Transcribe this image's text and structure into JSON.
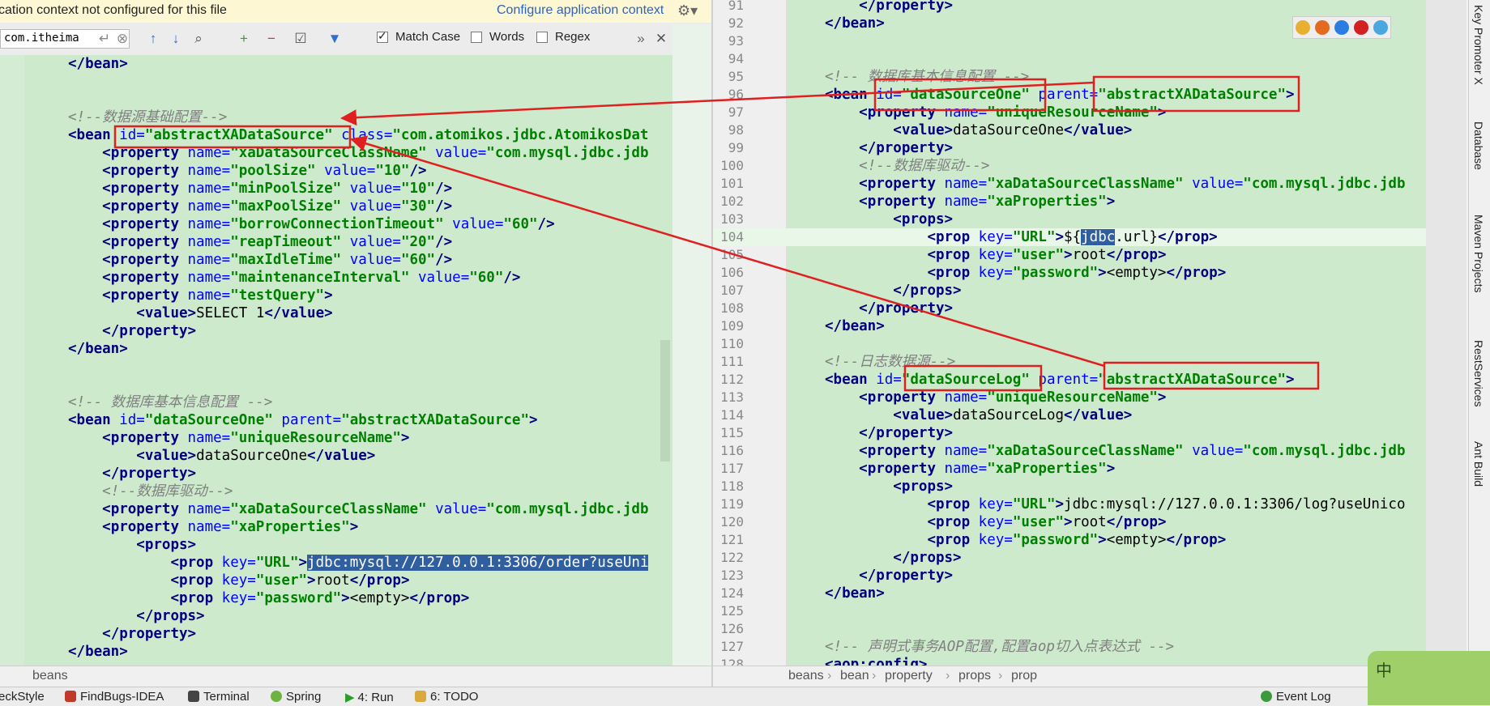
{
  "notice": {
    "message": "cation context not configured for this file",
    "link": "Configure application context"
  },
  "find": {
    "query": "com.itheima",
    "match_case": "Match Case",
    "words": "Words",
    "regex": "Regex",
    "match_case_checked": true,
    "words_checked": false,
    "regex_checked": false
  },
  "left_lines": [
    [
      [
        "t",
        "</bean>"
      ]
    ],
    [],
    [],
    [
      [
        "cm",
        "<!--数据源基础配置-->"
      ]
    ],
    [
      [
        "t",
        "<bean "
      ],
      [
        "an",
        "id="
      ],
      [
        "av",
        "\"abstractXADataSource\""
      ],
      [
        "tx",
        " "
      ],
      [
        "an",
        "class="
      ],
      [
        "av",
        "\"com.atomikos.jdbc.AtomikosDat"
      ]
    ],
    [
      [
        "tx",
        "    "
      ],
      [
        "t",
        "<property "
      ],
      [
        "an",
        "name="
      ],
      [
        "av",
        "\"xaDataSourceClassName\""
      ],
      [
        "tx",
        " "
      ],
      [
        "an",
        "value="
      ],
      [
        "av",
        "\"com.mysql.jdbc.jdb"
      ]
    ],
    [
      [
        "tx",
        "    "
      ],
      [
        "t",
        "<property "
      ],
      [
        "an",
        "name="
      ],
      [
        "av",
        "\"poolSize\""
      ],
      [
        "tx",
        " "
      ],
      [
        "an",
        "value="
      ],
      [
        "av",
        "\"10\""
      ],
      [
        "t",
        "/>"
      ]
    ],
    [
      [
        "tx",
        "    "
      ],
      [
        "t",
        "<property "
      ],
      [
        "an",
        "name="
      ],
      [
        "av",
        "\"minPoolSize\""
      ],
      [
        "tx",
        " "
      ],
      [
        "an",
        "value="
      ],
      [
        "av",
        "\"10\""
      ],
      [
        "t",
        "/>"
      ]
    ],
    [
      [
        "tx",
        "    "
      ],
      [
        "t",
        "<property "
      ],
      [
        "an",
        "name="
      ],
      [
        "av",
        "\"maxPoolSize\""
      ],
      [
        "tx",
        " "
      ],
      [
        "an",
        "value="
      ],
      [
        "av",
        "\"30\""
      ],
      [
        "t",
        "/>"
      ]
    ],
    [
      [
        "tx",
        "    "
      ],
      [
        "t",
        "<property "
      ],
      [
        "an",
        "name="
      ],
      [
        "av",
        "\"borrowConnectionTimeout\""
      ],
      [
        "tx",
        " "
      ],
      [
        "an",
        "value="
      ],
      [
        "av",
        "\"60\""
      ],
      [
        "t",
        "/>"
      ]
    ],
    [
      [
        "tx",
        "    "
      ],
      [
        "t",
        "<property "
      ],
      [
        "an",
        "name="
      ],
      [
        "av",
        "\"reapTimeout\""
      ],
      [
        "tx",
        " "
      ],
      [
        "an",
        "value="
      ],
      [
        "av",
        "\"20\""
      ],
      [
        "t",
        "/>"
      ]
    ],
    [
      [
        "tx",
        "    "
      ],
      [
        "t",
        "<property "
      ],
      [
        "an",
        "name="
      ],
      [
        "av",
        "\"maxIdleTime\""
      ],
      [
        "tx",
        " "
      ],
      [
        "an",
        "value="
      ],
      [
        "av",
        "\"60\""
      ],
      [
        "t",
        "/>"
      ]
    ],
    [
      [
        "tx",
        "    "
      ],
      [
        "t",
        "<property "
      ],
      [
        "an",
        "name="
      ],
      [
        "av",
        "\"maintenanceInterval\""
      ],
      [
        "tx",
        " "
      ],
      [
        "an",
        "value="
      ],
      [
        "av",
        "\"60\""
      ],
      [
        "t",
        "/>"
      ]
    ],
    [
      [
        "tx",
        "    "
      ],
      [
        "t",
        "<property "
      ],
      [
        "an",
        "name="
      ],
      [
        "av",
        "\"testQuery\""
      ],
      [
        "t",
        ">"
      ]
    ],
    [
      [
        "tx",
        "        "
      ],
      [
        "t",
        "<value>"
      ],
      [
        "tx",
        "SELECT 1"
      ],
      [
        "t",
        "</value>"
      ]
    ],
    [
      [
        "tx",
        "    "
      ],
      [
        "t",
        "</property>"
      ]
    ],
    [
      [
        "t",
        "</bean>"
      ]
    ],
    [],
    [],
    [
      [
        "cm",
        "<!-- 数据库基本信息配置 -->"
      ]
    ],
    [
      [
        "t",
        "<bean "
      ],
      [
        "an",
        "id="
      ],
      [
        "av",
        "\"dataSourceOne\""
      ],
      [
        "tx",
        " "
      ],
      [
        "an",
        "parent="
      ],
      [
        "av",
        "\"abstractXADataSource\""
      ],
      [
        "t",
        ">"
      ]
    ],
    [
      [
        "tx",
        "    "
      ],
      [
        "t",
        "<property "
      ],
      [
        "an",
        "name="
      ],
      [
        "av",
        "\"uniqueResourceName\""
      ],
      [
        "t",
        ">"
      ]
    ],
    [
      [
        "tx",
        "        "
      ],
      [
        "t",
        "<value>"
      ],
      [
        "tx",
        "dataSourceOne"
      ],
      [
        "t",
        "</value>"
      ]
    ],
    [
      [
        "tx",
        "    "
      ],
      [
        "t",
        "</property>"
      ]
    ],
    [
      [
        "tx",
        "    "
      ],
      [
        "cm",
        "<!--数据库驱动-->"
      ]
    ],
    [
      [
        "tx",
        "    "
      ],
      [
        "t",
        "<property "
      ],
      [
        "an",
        "name="
      ],
      [
        "av",
        "\"xaDataSourceClassName\""
      ],
      [
        "tx",
        " "
      ],
      [
        "an",
        "value="
      ],
      [
        "av",
        "\"com.mysql.jdbc.jdb"
      ]
    ],
    [
      [
        "tx",
        "    "
      ],
      [
        "t",
        "<property "
      ],
      [
        "an",
        "name="
      ],
      [
        "av",
        "\"xaProperties\""
      ],
      [
        "t",
        ">"
      ]
    ],
    [
      [
        "tx",
        "        "
      ],
      [
        "t",
        "<props>"
      ]
    ],
    [
      [
        "tx",
        "            "
      ],
      [
        "t",
        "<prop "
      ],
      [
        "an",
        "key="
      ],
      [
        "av",
        "\"URL\""
      ],
      [
        "t",
        ">"
      ],
      [
        "sel",
        "jdbc:mysql://127.0.0.1:3306/order?useUni"
      ]
    ],
    [
      [
        "tx",
        "            "
      ],
      [
        "t",
        "<prop "
      ],
      [
        "an",
        "key="
      ],
      [
        "av",
        "\"user\""
      ],
      [
        "t",
        ">"
      ],
      [
        "tx",
        "root"
      ],
      [
        "t",
        "</prop>"
      ]
    ],
    [
      [
        "tx",
        "            "
      ],
      [
        "t",
        "<prop "
      ],
      [
        "an",
        "key="
      ],
      [
        "av",
        "\"password\""
      ],
      [
        "t",
        ">"
      ],
      [
        "tx",
        "<empty>"
      ],
      [
        "t",
        "</prop>"
      ]
    ],
    [
      [
        "tx",
        "        "
      ],
      [
        "t",
        "</props>"
      ]
    ],
    [
      [
        "tx",
        "    "
      ],
      [
        "t",
        "</property>"
      ]
    ],
    [
      [
        "t",
        "</bean>"
      ]
    ]
  ],
  "right_lines": [
    {
      "n": "91",
      "c": [
        [
          "tx",
          "    "
        ],
        [
          "t",
          "</property>"
        ]
      ]
    },
    {
      "n": "92",
      "c": [
        [
          "t",
          "</bean>"
        ]
      ]
    },
    {
      "n": "93",
      "c": []
    },
    {
      "n": "94",
      "c": []
    },
    {
      "n": "95",
      "c": [
        [
          "cm",
          "<!-- 数据库基本信息配置 -->"
        ]
      ]
    },
    {
      "n": "96",
      "c": [
        [
          "t",
          "<bean "
        ],
        [
          "an",
          "id="
        ],
        [
          "av",
          "\"dataSourceOne\""
        ],
        [
          "tx",
          " "
        ],
        [
          "an",
          "parent="
        ],
        [
          "av",
          "\"abstractXADataSource\""
        ],
        [
          "t",
          ">"
        ]
      ]
    },
    {
      "n": "97",
      "c": [
        [
          "tx",
          "    "
        ],
        [
          "t",
          "<property "
        ],
        [
          "an",
          "name="
        ],
        [
          "av",
          "\"uniqueResourceName\""
        ],
        [
          "t",
          ">"
        ]
      ]
    },
    {
      "n": "98",
      "c": [
        [
          "tx",
          "        "
        ],
        [
          "t",
          "<value>"
        ],
        [
          "tx",
          "dataSourceOne"
        ],
        [
          "t",
          "</value>"
        ]
      ]
    },
    {
      "n": "99",
      "c": [
        [
          "tx",
          "    "
        ],
        [
          "t",
          "</property>"
        ]
      ]
    },
    {
      "n": "100",
      "c": [
        [
          "tx",
          "    "
        ],
        [
          "cm",
          "<!--数据库驱动-->"
        ]
      ]
    },
    {
      "n": "101",
      "c": [
        [
          "tx",
          "    "
        ],
        [
          "t",
          "<property "
        ],
        [
          "an",
          "name="
        ],
        [
          "av",
          "\"xaDataSourceClassName\""
        ],
        [
          "tx",
          " "
        ],
        [
          "an",
          "value="
        ],
        [
          "av",
          "\"com.mysql.jdbc.jdb"
        ]
      ]
    },
    {
      "n": "102",
      "c": [
        [
          "tx",
          "    "
        ],
        [
          "t",
          "<property "
        ],
        [
          "an",
          "name="
        ],
        [
          "av",
          "\"xaProperties\""
        ],
        [
          "t",
          ">"
        ]
      ]
    },
    {
      "n": "103",
      "c": [
        [
          "tx",
          "        "
        ],
        [
          "t",
          "<props>"
        ]
      ]
    },
    {
      "n": "104",
      "c": [
        [
          "tx",
          "            "
        ],
        [
          "t",
          "<prop "
        ],
        [
          "an",
          "key="
        ],
        [
          "av",
          "\"URL\""
        ],
        [
          "t",
          ">"
        ],
        [
          "tx",
          "${"
        ],
        [
          "sel",
          "jdbc"
        ],
        [
          "tx",
          ".url}"
        ],
        [
          "t",
          "</prop>"
        ]
      ]
    },
    {
      "n": "105",
      "c": [
        [
          "tx",
          "            "
        ],
        [
          "t",
          "<prop "
        ],
        [
          "an",
          "key="
        ],
        [
          "av",
          "\"user\""
        ],
        [
          "t",
          ">"
        ],
        [
          "tx",
          "root"
        ],
        [
          "t",
          "</prop>"
        ]
      ]
    },
    {
      "n": "106",
      "c": [
        [
          "tx",
          "            "
        ],
        [
          "t",
          "<prop "
        ],
        [
          "an",
          "key="
        ],
        [
          "av",
          "\"password\""
        ],
        [
          "t",
          ">"
        ],
        [
          "tx",
          "<empty>"
        ],
        [
          "t",
          "</prop>"
        ]
      ]
    },
    {
      "n": "107",
      "c": [
        [
          "tx",
          "        "
        ],
        [
          "t",
          "</props>"
        ]
      ]
    },
    {
      "n": "108",
      "c": [
        [
          "tx",
          "    "
        ],
        [
          "t",
          "</property>"
        ]
      ]
    },
    {
      "n": "109",
      "c": [
        [
          "t",
          "</bean>"
        ]
      ]
    },
    {
      "n": "110",
      "c": []
    },
    {
      "n": "111",
      "c": [
        [
          "cm",
          "<!--日志数据源-->"
        ]
      ]
    },
    {
      "n": "112",
      "c": [
        [
          "t",
          "<bean "
        ],
        [
          "an",
          "id="
        ],
        [
          "av",
          "\"dataSourceLog\""
        ],
        [
          "tx",
          " "
        ],
        [
          "an",
          "parent="
        ],
        [
          "av",
          "\"abstractXADataSource\""
        ],
        [
          "t",
          ">"
        ]
      ]
    },
    {
      "n": "113",
      "c": [
        [
          "tx",
          "    "
        ],
        [
          "t",
          "<property "
        ],
        [
          "an",
          "name="
        ],
        [
          "av",
          "\"uniqueResourceName\""
        ],
        [
          "t",
          ">"
        ]
      ]
    },
    {
      "n": "114",
      "c": [
        [
          "tx",
          "        "
        ],
        [
          "t",
          "<value>"
        ],
        [
          "tx",
          "dataSourceLog"
        ],
        [
          "t",
          "</value>"
        ]
      ]
    },
    {
      "n": "115",
      "c": [
        [
          "tx",
          "    "
        ],
        [
          "t",
          "</property>"
        ]
      ]
    },
    {
      "n": "116",
      "c": [
        [
          "tx",
          "    "
        ],
        [
          "t",
          "<property "
        ],
        [
          "an",
          "name="
        ],
        [
          "av",
          "\"xaDataSourceClassName\""
        ],
        [
          "tx",
          " "
        ],
        [
          "an",
          "value="
        ],
        [
          "av",
          "\"com.mysql.jdbc.jdb"
        ]
      ]
    },
    {
      "n": "117",
      "c": [
        [
          "tx",
          "    "
        ],
        [
          "t",
          "<property "
        ],
        [
          "an",
          "name="
        ],
        [
          "av",
          "\"xaProperties\""
        ],
        [
          "t",
          ">"
        ]
      ]
    },
    {
      "n": "118",
      "c": [
        [
          "tx",
          "        "
        ],
        [
          "t",
          "<props>"
        ]
      ]
    },
    {
      "n": "119",
      "c": [
        [
          "tx",
          "            "
        ],
        [
          "t",
          "<prop "
        ],
        [
          "an",
          "key="
        ],
        [
          "av",
          "\"URL\""
        ],
        [
          "t",
          ">"
        ],
        [
          "tx",
          "jdbc:mysql://127.0.0.1:3306/log?useUnico"
        ]
      ]
    },
    {
      "n": "120",
      "c": [
        [
          "tx",
          "            "
        ],
        [
          "t",
          "<prop "
        ],
        [
          "an",
          "key="
        ],
        [
          "av",
          "\"user\""
        ],
        [
          "t",
          ">"
        ],
        [
          "tx",
          "root"
        ],
        [
          "t",
          "</prop>"
        ]
      ]
    },
    {
      "n": "121",
      "c": [
        [
          "tx",
          "            "
        ],
        [
          "t",
          "<prop "
        ],
        [
          "an",
          "key="
        ],
        [
          "av",
          "\"password\""
        ],
        [
          "t",
          ">"
        ],
        [
          "tx",
          "<empty>"
        ],
        [
          "t",
          "</prop>"
        ]
      ]
    },
    {
      "n": "122",
      "c": [
        [
          "tx",
          "        "
        ],
        [
          "t",
          "</props>"
        ]
      ]
    },
    {
      "n": "123",
      "c": [
        [
          "tx",
          "    "
        ],
        [
          "t",
          "</property>"
        ]
      ]
    },
    {
      "n": "124",
      "c": [
        [
          "t",
          "</bean>"
        ]
      ]
    },
    {
      "n": "125",
      "c": []
    },
    {
      "n": "126",
      "c": []
    },
    {
      "n": "127",
      "c": [
        [
          "cm",
          "<!-- 声明式事务AOP配置,配置aop切入点表达式 -->"
        ]
      ]
    },
    {
      "n": "128",
      "c": [
        [
          "t",
          "<aop:config>"
        ]
      ]
    }
  ],
  "breadcrumbs_left": [
    "beans"
  ],
  "breadcrumbs_right": [
    "beans",
    "bean",
    "property",
    "props",
    "prop"
  ],
  "side_tabs": [
    "Key Promoter X",
    "Database",
    "Maven Projects",
    "RestServices",
    "Ant Build"
  ],
  "status_items": [
    "eckStyle",
    "FindBugs-IDEA",
    "Terminal",
    "Spring",
    "4: Run",
    "6: TODO",
    "Event Log"
  ],
  "ime_label": "中",
  "colors": {
    "editor_bg": "#cdeacd",
    "annotation": "#e02020",
    "selection": "#2f5f9f"
  }
}
